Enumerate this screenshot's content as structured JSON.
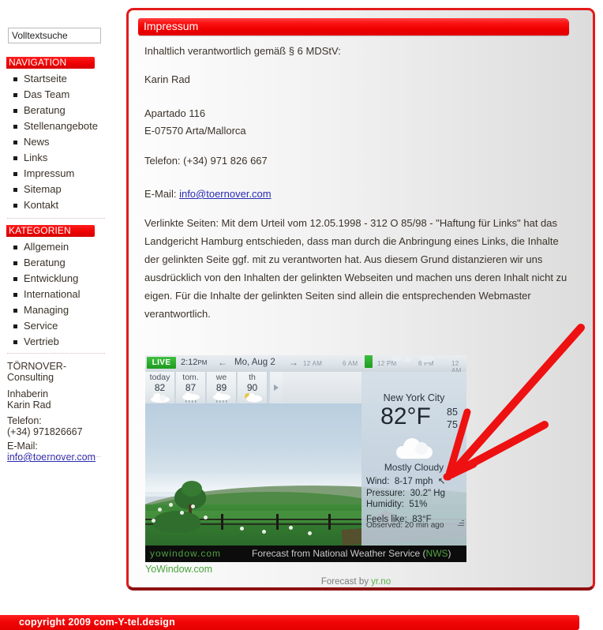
{
  "search": {
    "value": "Volltextsuche",
    "placeholder": "Volltextsuche"
  },
  "sidebar": {
    "navigation_heading": "NAVIGATION",
    "navigation_items": [
      {
        "label": "Startseite"
      },
      {
        "label": "Das Team"
      },
      {
        "label": "Beratung"
      },
      {
        "label": "Stellenangebote"
      },
      {
        "label": "News"
      },
      {
        "label": "Links"
      },
      {
        "label": "Impressum"
      },
      {
        "label": "Sitemap"
      },
      {
        "label": "Kontakt"
      }
    ],
    "categories_heading": "KATEGORIEN",
    "category_items": [
      {
        "label": "Allgemein"
      },
      {
        "label": "Beratung"
      },
      {
        "label": "Entwicklung"
      },
      {
        "label": "International"
      },
      {
        "label": "Managing"
      },
      {
        "label": "Service"
      },
      {
        "label": "Vertrieb"
      }
    ],
    "contact": {
      "company_line1": "TÖRNOVER-",
      "company_line2": "Consulting",
      "owner_label": "Inhaberin",
      "owner_name": "Karin Rad",
      "phone_label": "Telefon:",
      "phone_value": "(+34) 971826667",
      "email_label": "E-Mail:",
      "email_value": "info@toernover.com"
    }
  },
  "main": {
    "title": "Impressum",
    "responsible_line": "Inhaltlich verantwortlich gemäß § 6 MDStV:",
    "name": "Karin Rad",
    "address_line1": "Apartado 116",
    "address_line2": "E-07570 Arta/Mallorca",
    "phone": "Telefon: (+34) 971 826 667",
    "email_label": "E-Mail:",
    "email_value": "info@toernover.com",
    "disclaimer": "Verlinkte Seiten: Mit dem Urteil vom 12.05.1998 - 312 O 85/98 - \"Haftung für Links\" hat das Landgericht Hamburg entschieden, dass man durch die Anbringung eines Links, die Inhalte der gelinkten Seite ggf. mit zu verantworten hat. Aus diesem Grund distanzieren wir uns ausdrücklich von den Inhalten der gelinkten Webseiten und machen uns deren Inhalt nicht zu eigen. Für die Inhalte der gelinkten Seiten sind allein die entsprechenden Webmaster verantwortlich.",
    "yowindow_link": "YoWindow.com",
    "forecast_by_prefix": "Forecast by ",
    "forecast_by_source": "yr.no"
  },
  "weather": {
    "live_badge": "LIVE",
    "time": "2:12",
    "time_ampm": "PM",
    "date": "Mo, Aug 2",
    "prev_arrow": "←",
    "next_arrow": "→",
    "timeline_ticks": [
      "12 AM",
      "6 AM",
      "12 PM",
      "6 PM",
      "12 AM"
    ],
    "days": [
      {
        "name": "today",
        "temp": "82",
        "icon": "cloud-icon"
      },
      {
        "name": "tom.",
        "temp": "87",
        "icon": "rain-icon"
      },
      {
        "name": "we",
        "temp": "89",
        "icon": "rain-icon"
      },
      {
        "name": "th",
        "temp": "90",
        "icon": "sun-cloud-icon"
      }
    ],
    "city": "New York City",
    "temperature": "82°F",
    "high": "85",
    "low": "75",
    "condition": "Mostly Cloudy",
    "details": [
      {
        "label": "Wind:",
        "value": "8-17 mph"
      },
      {
        "label": "Pressure:",
        "value": "30.2\" Hg"
      },
      {
        "label": "Humidity:",
        "value": "51%"
      },
      {
        "label": "Feels like:",
        "value": "83°F"
      }
    ],
    "observed": "Observed:  20 min ago",
    "brand": "yowindow.com",
    "source_prefix": "Forecast from National Weather Service (",
    "source_name": "NWS",
    "source_suffix": ")"
  },
  "footer": {
    "copyright": "copyright 2009 com-Y-tel.design"
  },
  "colors": {
    "accent_red": "#ee0000",
    "dark_red": "#8d1111",
    "link_blue": "#2a2ab4",
    "green": "#4aa33c",
    "annotation_red": "#ee1111"
  }
}
